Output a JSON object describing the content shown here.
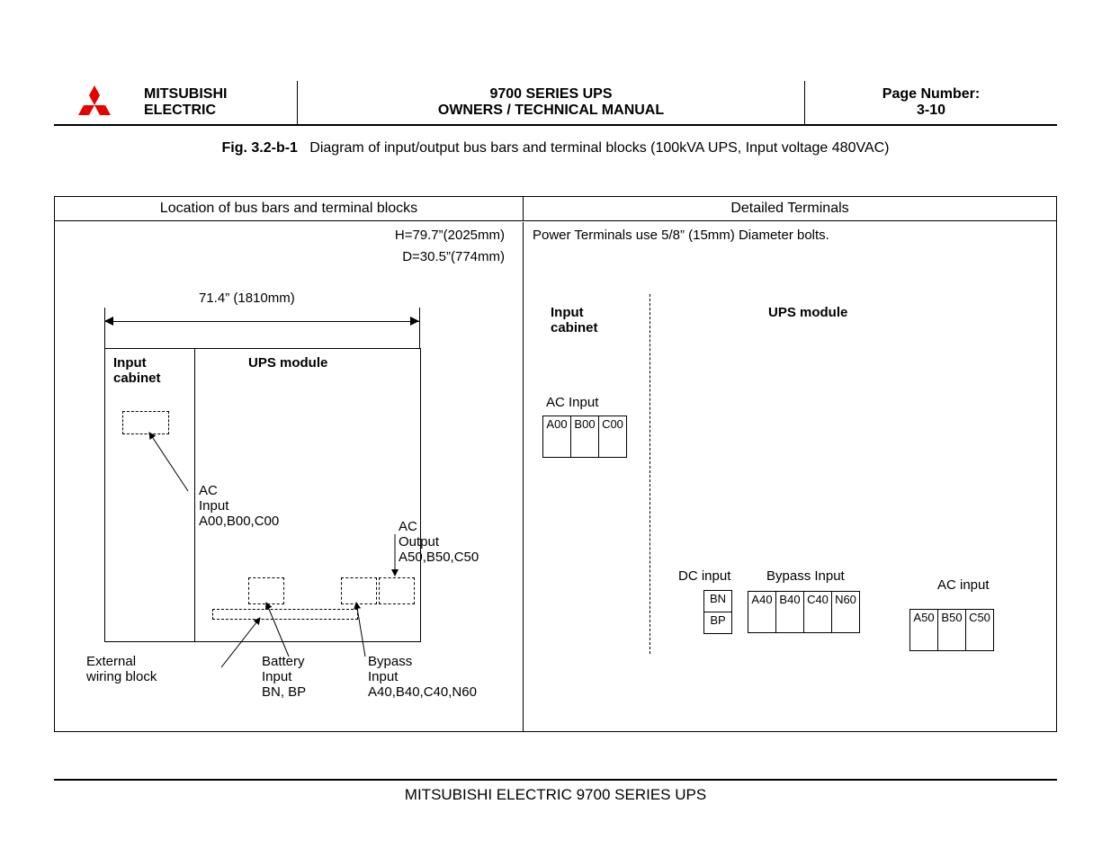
{
  "header": {
    "brand1": "MITSUBISHI",
    "brand2": "ELECTRIC",
    "title1": "9700 SERIES UPS",
    "title2": "OWNERS / TECHNICAL MANUAL",
    "page_label": "Page Number:",
    "page_value": "3-10"
  },
  "figure": {
    "number": "Fig. 3.2-b-1",
    "caption": "Diagram of input/output bus bars and terminal blocks (100kVA UPS, Input voltage 480VAC)"
  },
  "col_headers": {
    "left": "Location of bus bars and terminal blocks",
    "right": "Detailed Terminals"
  },
  "left": {
    "h_dim": "H=79.7”(2025mm)",
    "d_dim": "D=30.5”(774mm)",
    "w_dim": "71.4” (1810mm)",
    "input_cabinet": "Input\ncabinet",
    "ups_module": "UPS module",
    "ac_input": "AC\nInput\nA00,B00,C00",
    "ac_output": "AC\nOutput\nA50,B50,C50",
    "ext_wiring": "External\nwiring block",
    "battery_input": "Battery\nInput\nBN, BP",
    "bypass_input": "Bypass\nInput\nA40,B40,C40,N60"
  },
  "right": {
    "bolt_note": "Power Terminals use 5/8” (15mm) Diameter bolts.",
    "input_cabinet": "Input\ncabinet",
    "ups_module": "UPS module",
    "ac_input_label": "AC Input",
    "ac_input_terms": [
      "A00",
      "B00",
      "C00"
    ],
    "dc_input_label": "DC input",
    "dc_input_terms": [
      "BN",
      "BP"
    ],
    "bypass_label": "Bypass Input",
    "bypass_terms": [
      "A40",
      "B40",
      "C40",
      "N60"
    ],
    "ac_input_right_label": "AC input",
    "ac_output_terms": [
      "A50",
      "B50",
      "C50"
    ]
  },
  "footer": "MITSUBISHI ELECTRIC 9700 SERIES UPS"
}
